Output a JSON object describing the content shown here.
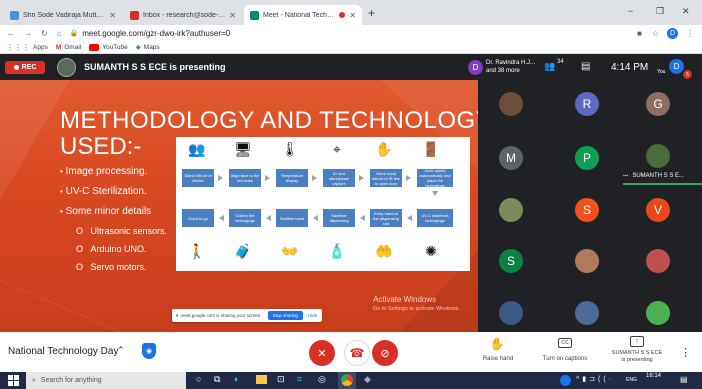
{
  "browser": {
    "tabs": [
      {
        "title": "Shri Sode Vadiraja Mutt Educatio",
        "favicon_color": "#4a90d9",
        "active": false
      },
      {
        "title": "Inbox - research@sode-edu.in",
        "favicon_color": "#d93025",
        "active": false
      },
      {
        "title": "Meet - National Technolog",
        "favicon_color": "#00897b",
        "active": true
      }
    ],
    "new_tab_label": "+",
    "window_controls": [
      "−",
      "❐",
      "✕"
    ],
    "address": "meet.google.com/gzr-dwo-irk?authuser=0",
    "bookmarks": [
      "Apps",
      "Gmail",
      "YouTube",
      "Maps"
    ],
    "profile_initial": "D"
  },
  "meet": {
    "rec_label": "REC",
    "presenting_label": "SUMANTH S S ECE is presenting",
    "participant_chip_initial": "D",
    "participant_chip_name": "Dr. Ravindra H.J...",
    "participant_chip_more": "and 38 more",
    "people_count": "34",
    "time": "4:14 PM",
    "you_label": "You",
    "you_initial": "D",
    "notif_count": "5",
    "grid_tiles": [
      {
        "type": "photo",
        "initial": "",
        "color": "#6b4f3a"
      },
      {
        "type": "letter",
        "initial": "R",
        "color": "#5c6bc0"
      },
      {
        "type": "letter",
        "initial": "G",
        "color": "#8d6e63"
      },
      {
        "type": "letter",
        "initial": "M",
        "color": "#5f6368"
      },
      {
        "type": "letter",
        "initial": "P",
        "color": "#0f9d58"
      },
      {
        "type": "photo",
        "initial": "",
        "color": "#4a6b3a"
      },
      {
        "type": "photo",
        "initial": "",
        "color": "#7a8a5a"
      },
      {
        "type": "letter",
        "initial": "S",
        "color": "#f4511e"
      },
      {
        "type": "letter",
        "initial": "V",
        "color": "#e64a19"
      },
      {
        "type": "letter",
        "initial": "S",
        "color": "#0b8043"
      },
      {
        "type": "photo",
        "initial": "",
        "color": "#b07a5a"
      },
      {
        "type": "photo",
        "initial": "",
        "color": "#c0504d"
      },
      {
        "type": "photo",
        "initial": "",
        "color": "#3a5a8a"
      },
      {
        "type": "photo",
        "initial": "",
        "color": "#4a6a9a"
      },
      {
        "type": "photo",
        "initial": "",
        "color": "#4caf50"
      }
    ],
    "presenter_tile_label": "SUMANTH S S E..."
  },
  "slide": {
    "title_line1": "METHODOLOGY AND TECHNOLOGY",
    "title_line2": "USED:-",
    "bullets": [
      "Image processing.",
      "UV-C Sterilization.",
      "Some minor details"
    ],
    "sub_bullets": [
      "Ultrasonic sensors.",
      "Arduino UNO.",
      "Servo motors."
    ],
    "flow_top": [
      "Stand infront of device",
      "Align face to the red mark",
      "Temperature display",
      "ID and attendance capture",
      "Wave hand infront of IR line to open door",
      "Door opens automatically and place the belongings"
    ],
    "flow_bottom": [
      "Good to go",
      "Collect the belongings",
      "Sanitise hand",
      "Sanitiser dispensing",
      "Keep hand at the dispensing slot",
      "UV-C disinfects belongings"
    ],
    "share_notice": "meet.google.com is sharing your screen.",
    "stop_sharing": "Stop sharing",
    "hide": "Hide",
    "activate_title": "Activate Windows",
    "activate_sub": "Go to Settings to activate Windows."
  },
  "bottom": {
    "meeting_name": "National Technology Day",
    "raise_hand": "Raise hand",
    "captions": "Turn on captions",
    "presenting_line1": "SUMANTH S S ECE",
    "presenting_line2": "is presenting"
  },
  "taskbar": {
    "search_placeholder": "Search for anything",
    "clock_time": "16:14",
    "lang": "ENG"
  }
}
